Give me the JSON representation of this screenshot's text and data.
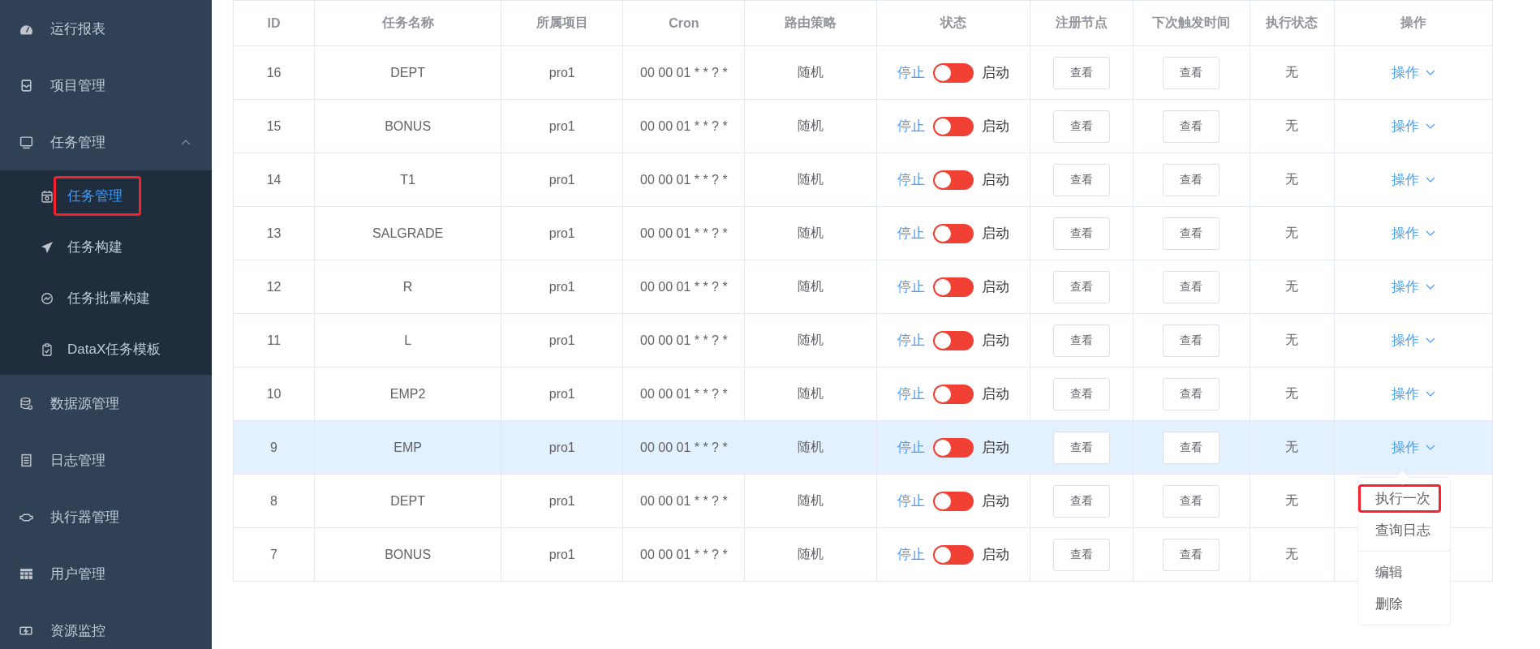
{
  "sidebar": {
    "items": [
      {
        "label": "运行报表",
        "selected": false
      },
      {
        "label": "项目管理",
        "selected": false
      },
      {
        "label": "任务管理",
        "selected": false,
        "expanded": true,
        "children": [
          {
            "label": "任务管理",
            "selected": true,
            "highlighted": true
          },
          {
            "label": "任务构建",
            "selected": false,
            "highlighted": false
          },
          {
            "label": "任务批量构建",
            "selected": false,
            "highlighted": false
          },
          {
            "label": "DataX任务模板",
            "selected": false,
            "highlighted": false
          }
        ]
      },
      {
        "label": "数据源管理",
        "selected": false
      },
      {
        "label": "日志管理",
        "selected": false
      },
      {
        "label": "执行器管理",
        "selected": false
      },
      {
        "label": "用户管理",
        "selected": false
      },
      {
        "label": "资源监控",
        "selected": false
      }
    ]
  },
  "table": {
    "columns": [
      "ID",
      "任务名称",
      "所属项目",
      "Cron",
      "路由策略",
      "状态",
      "注册节点",
      "下次触发时间",
      "执行状态",
      "操作"
    ],
    "rows": [
      {
        "id": "16",
        "name": "DEPT",
        "project": "pro1",
        "cron": "00 00 01 * * ? *",
        "route": "随机",
        "off_label": "停止",
        "on_label": "启动",
        "on": false,
        "nodes": "查看",
        "next": "查看",
        "exec": "无",
        "action": "操作",
        "selected": false
      },
      {
        "id": "15",
        "name": "BONUS",
        "project": "pro1",
        "cron": "00 00 01 * * ? *",
        "route": "随机",
        "off_label": "停止",
        "on_label": "启动",
        "on": false,
        "nodes": "查看",
        "next": "查看",
        "exec": "无",
        "action": "操作",
        "selected": false
      },
      {
        "id": "14",
        "name": "T1",
        "project": "pro1",
        "cron": "00 00 01 * * ? *",
        "route": "随机",
        "off_label": "停止",
        "on_label": "启动",
        "on": false,
        "nodes": "查看",
        "next": "查看",
        "exec": "无",
        "action": "操作",
        "selected": false
      },
      {
        "id": "13",
        "name": "SALGRADE",
        "project": "pro1",
        "cron": "00 00 01 * * ? *",
        "route": "随机",
        "off_label": "停止",
        "on_label": "启动",
        "on": false,
        "nodes": "查看",
        "next": "查看",
        "exec": "无",
        "action": "操作",
        "selected": false
      },
      {
        "id": "12",
        "name": "R",
        "project": "pro1",
        "cron": "00 00 01 * * ? *",
        "route": "随机",
        "off_label": "停止",
        "on_label": "启动",
        "on": false,
        "nodes": "查看",
        "next": "查看",
        "exec": "无",
        "action": "操作",
        "selected": false
      },
      {
        "id": "11",
        "name": "L",
        "project": "pro1",
        "cron": "00 00 01 * * ? *",
        "route": "随机",
        "off_label": "停止",
        "on_label": "启动",
        "on": false,
        "nodes": "查看",
        "next": "查看",
        "exec": "无",
        "action": "操作",
        "selected": false
      },
      {
        "id": "10",
        "name": "EMP2",
        "project": "pro1",
        "cron": "00 00 01 * * ? *",
        "route": "随机",
        "off_label": "停止",
        "on_label": "启动",
        "on": false,
        "nodes": "查看",
        "next": "查看",
        "exec": "无",
        "action": "操作",
        "selected": false
      },
      {
        "id": "9",
        "name": "EMP",
        "project": "pro1",
        "cron": "00 00 01 * * ? *",
        "route": "随机",
        "off_label": "停止",
        "on_label": "启动",
        "on": false,
        "nodes": "查看",
        "next": "查看",
        "exec": "无",
        "action": "操作",
        "selected": true
      },
      {
        "id": "8",
        "name": "DEPT",
        "project": "pro1",
        "cron": "00 00 01 * * ? *",
        "route": "随机",
        "off_label": "停止",
        "on_label": "启动",
        "on": false,
        "nodes": "查看",
        "next": "查看",
        "exec": "无",
        "selected": false
      },
      {
        "id": "7",
        "name": "BONUS",
        "project": "pro1",
        "cron": "00 00 01 * * ? *",
        "route": "随机",
        "off_label": "停止",
        "on_label": "启动",
        "on": false,
        "nodes": "查看",
        "next": "查看",
        "exec": "无",
        "selected": false
      }
    ]
  },
  "dropdown": {
    "groups": [
      [
        {
          "label": "执行一次",
          "highlighted": true
        },
        {
          "label": "查询日志",
          "highlighted": false
        }
      ],
      [
        {
          "label": "编辑",
          "highlighted": false
        },
        {
          "label": "删除",
          "highlighted": false
        }
      ]
    ]
  }
}
